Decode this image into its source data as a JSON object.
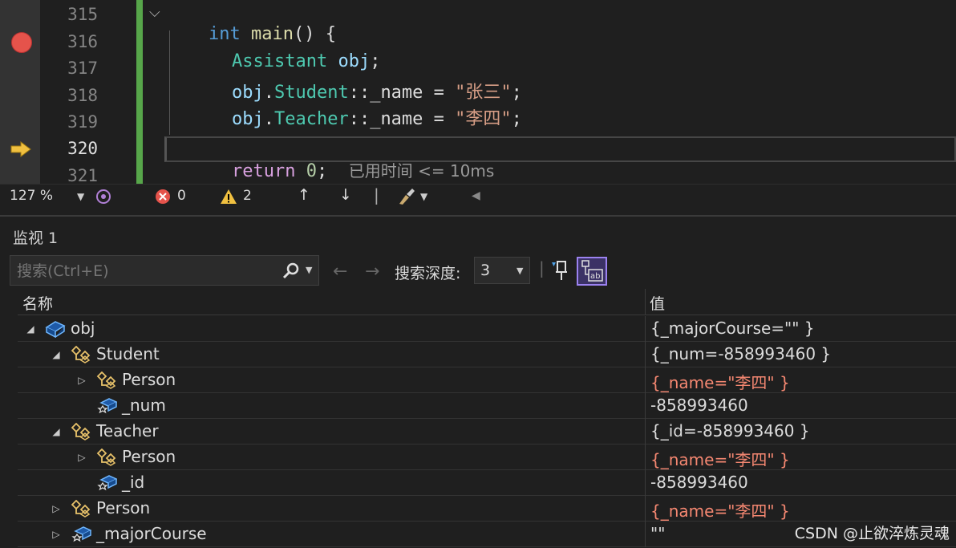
{
  "editor": {
    "lines": [
      {
        "num": "315"
      },
      {
        "num": "316"
      },
      {
        "num": "317"
      },
      {
        "num": "318"
      },
      {
        "num": "319"
      },
      {
        "num": "320"
      },
      {
        "num": "321"
      }
    ],
    "code": {
      "l315": {
        "kw": "int",
        "fn": "main",
        "rest": "() {"
      },
      "l316": {
        "type": "Assistant",
        "var": "obj",
        "end": ";"
      },
      "l317": {
        "var": "obj",
        "dot": ".",
        "type": "Student",
        "scope": "::_name = ",
        "str": "\"张三\"",
        "end": ";"
      },
      "l318": {
        "var": "obj",
        "dot": ".",
        "type": "Teacher",
        "scope": "::_name = ",
        "str": "\"李四\"",
        "end": ";"
      },
      "l320": {
        "kw": "return",
        "num": "0",
        "end": ";",
        "elapsed": "已用时间 <= 10ms"
      },
      "l321": {
        "rest": "}"
      }
    }
  },
  "status": {
    "zoom": "127 %",
    "errors": "0",
    "warnings": "2"
  },
  "watch": {
    "title": "监视 1",
    "search_placeholder": "搜索(Ctrl+E)",
    "depth_label": "搜索深度:",
    "depth_value": "3",
    "col_name": "名称",
    "col_value": "值",
    "rows": [
      {
        "name": "obj",
        "value": "{_majorCourse=\"\" }"
      },
      {
        "name": "Student",
        "value": "{_num=-858993460 }"
      },
      {
        "name": "Person",
        "value": "{_name=\"李四\" }"
      },
      {
        "name": "_num",
        "value": "-858993460"
      },
      {
        "name": "Teacher",
        "value": "{_id=-858993460 }"
      },
      {
        "name": "Person",
        "value": "{_name=\"李四\" }"
      },
      {
        "name": "_id",
        "value": "-858993460"
      },
      {
        "name": "Person",
        "value": "{_name=\"李四\" }"
      },
      {
        "name": "_majorCourse",
        "value": "\"\""
      }
    ]
  },
  "watermark": "CSDN @止欲淬炼灵魂",
  "colors": {
    "breakpoint": "#e5534b",
    "current_arrow": "#f0c040",
    "changed_value": "#f48771",
    "change_bar": "#57a64a"
  }
}
